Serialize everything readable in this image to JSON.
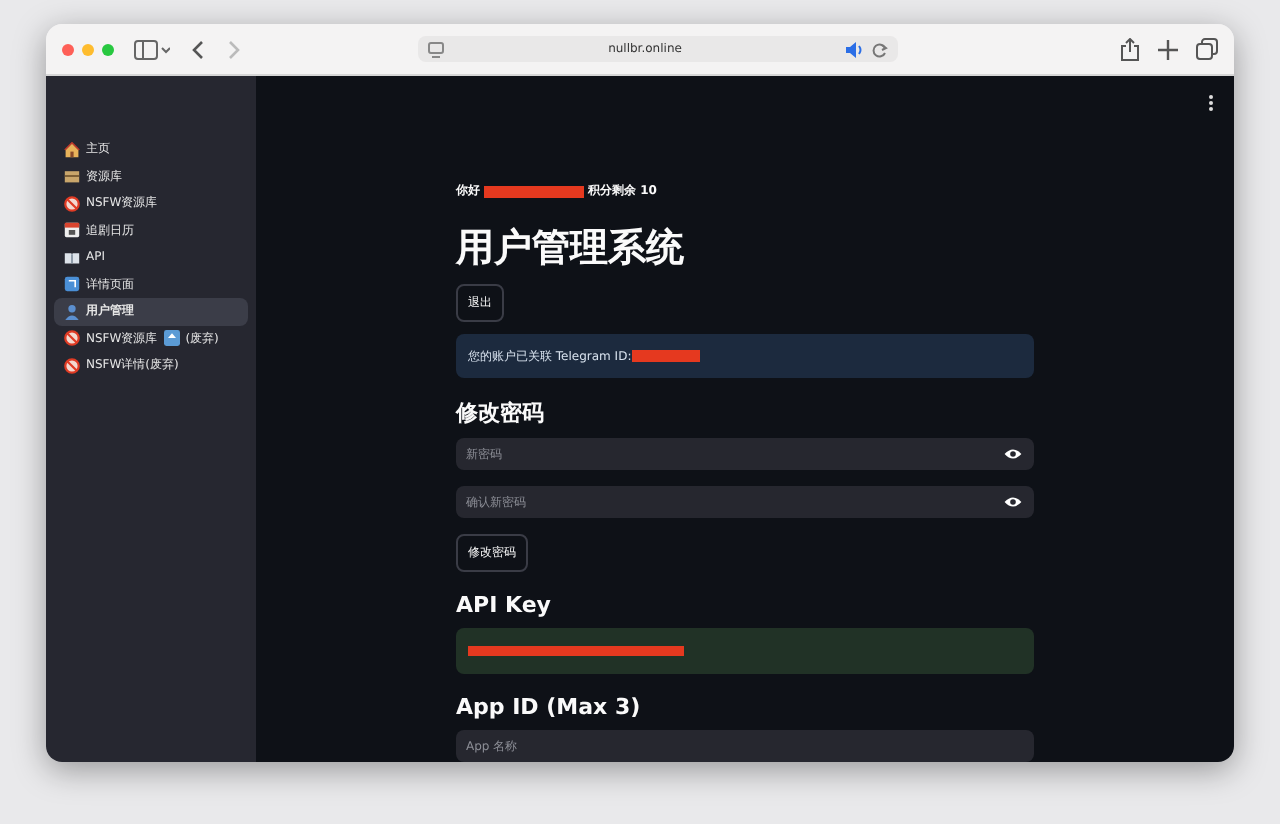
{
  "browser": {
    "url": "nullbr.online"
  },
  "sidebar": {
    "items": [
      {
        "label": "主页",
        "selected": false
      },
      {
        "label": "资源库",
        "selected": false
      },
      {
        "label": "NSFW资源库",
        "selected": false
      },
      {
        "label": "追剧日历",
        "selected": false
      },
      {
        "label": "API",
        "selected": false
      },
      {
        "label": "详情页面",
        "selected": false
      },
      {
        "label": "用户管理",
        "selected": true
      },
      {
        "label": "NSFW资源库",
        "suffix": "(废弃)",
        "badge_icon": true,
        "selected": false
      },
      {
        "label": "NSFW详情(废弃)",
        "selected": false
      }
    ]
  },
  "greeting": {
    "prefix": "你好",
    "suffix": "积分剩余 10"
  },
  "title": "用户管理系统",
  "logout_button": "退出",
  "telegram_notice": "您的账户已关联 Telegram ID:",
  "password_section": {
    "heading": "修改密码",
    "fields": [
      {
        "placeholder": "新密码"
      },
      {
        "placeholder": "确认新密码"
      }
    ],
    "button": "修改密码"
  },
  "api_key_section": {
    "heading": "API Key"
  },
  "app_id_section": {
    "heading": "App ID (Max 3)",
    "field": {
      "placeholder": "App 名称"
    }
  }
}
